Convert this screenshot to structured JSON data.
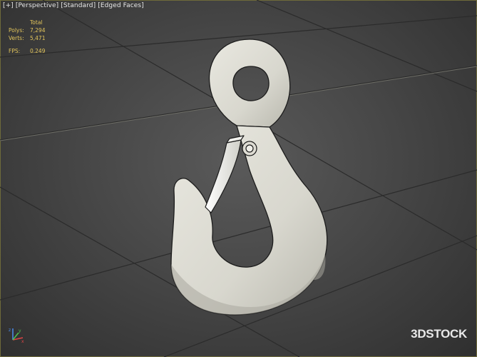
{
  "viewport": {
    "menu": [
      {
        "id": "plus",
        "label": "[+]"
      },
      {
        "id": "perspective",
        "label": "[Perspective]"
      },
      {
        "id": "standard",
        "label": "[Standard]"
      },
      {
        "id": "edged_faces",
        "label": "[Edged Faces]"
      }
    ],
    "stats": {
      "header": "Total",
      "polys_label": "Polys:",
      "polys_value": "7,294",
      "verts_label": "Verts:",
      "verts_value": "5,471",
      "fps_label": "FPS:",
      "fps_value": "0.249"
    },
    "gizmo": {
      "icon": "axis-tripod-icon",
      "x_label": "x",
      "y_label": "y",
      "z_label": "z"
    }
  },
  "watermark": "3DSTOCK",
  "colors": {
    "background": "#474747",
    "grid": "#2a2a2a",
    "stats_text": "#e3c55b",
    "model": "#dcdbd2",
    "frame_border": "#6e6a3a"
  }
}
